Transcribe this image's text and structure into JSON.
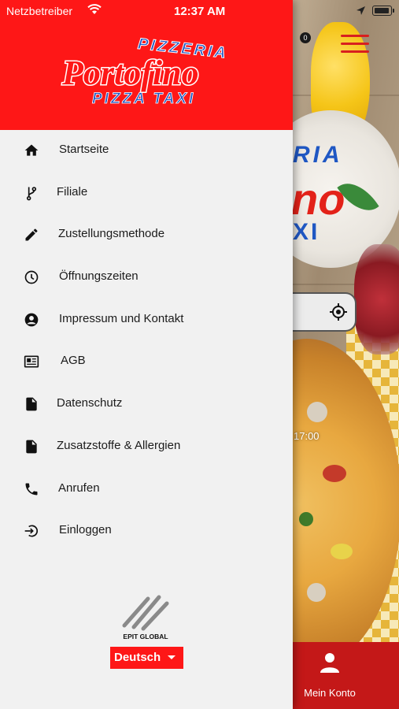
{
  "status_bar": {
    "carrier": "Netzbetreiber",
    "time": "12:37 AM"
  },
  "drawer": {
    "logo": {
      "line1": "PIZZERIA",
      "line2": "Portofino",
      "line3": "PIZZA TAXI",
      "colors": {
        "primary": "#fe1717",
        "secondary": "#1f57c3",
        "text": "#ffffff"
      }
    },
    "menu": [
      {
        "label": "Startseite",
        "icon": "home-icon"
      },
      {
        "label": "Filiale",
        "icon": "branch-icon"
      },
      {
        "label": "Zustellungsmethode",
        "icon": "pencil-icon"
      },
      {
        "label": "Öffnungszeiten",
        "icon": "clock-icon"
      },
      {
        "label": "Impressum und Kontakt",
        "icon": "account-circle-icon"
      },
      {
        "label": "AGB",
        "icon": "newspaper-icon"
      },
      {
        "label": "Datenschutz",
        "icon": "document-icon"
      },
      {
        "label": "Zusatzstoffe & Allergien",
        "icon": "document-icon"
      },
      {
        "label": "Anrufen",
        "icon": "phone-icon"
      },
      {
        "label": "Einloggen",
        "icon": "login-icon"
      }
    ],
    "footer": {
      "brand_name": "EPIT GLOBAL",
      "language": "Deutsch"
    }
  },
  "background": {
    "cart_count": "0",
    "time_label": "17:00",
    "logo_fragments": {
      "top": "RIA",
      "middle": "no",
      "bottom": "XI"
    },
    "bottom_tab": {
      "label": "Mein Konto",
      "icon": "person-icon"
    }
  },
  "colors": {
    "brand_red": "#fe1717",
    "drawer_bg": "#f1f1f1",
    "text": "#1b1b1b"
  }
}
